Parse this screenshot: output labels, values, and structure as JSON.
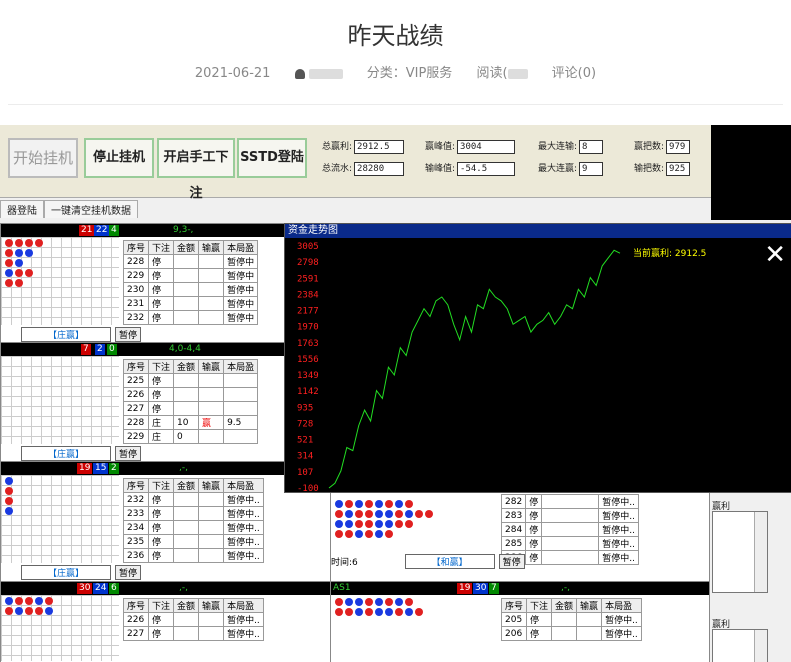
{
  "article": {
    "title": "昨天战绩",
    "date": "2021-06-21",
    "category": "分类：VIP服务",
    "reads": "阅读(",
    "comments": "评论(0)"
  },
  "toolbar": {
    "start": "开始挂机",
    "stop": "停止挂机",
    "manual": "开启手工下注",
    "login": "SSTD登陆",
    "total_win_label": "总赢利:",
    "total_win": "2912.5",
    "total_flow_label": "总流水:",
    "total_flow": "28280",
    "peak_win_label": "赢峰值:",
    "peak_win": "3004",
    "peak_loss_label": "输峰值:",
    "peak_loss": "-54.5",
    "max_win_streak_label": "最大连输:",
    "max_win_streak": "8",
    "max_loss_streak_label": "最大连赢:",
    "max_loss_streak": "9",
    "win_rounds_label": "赢把数:",
    "win_rounds": "979",
    "loss_rounds_label": "输把数:",
    "loss_rounds": "925"
  },
  "tabs": [
    "器登陆",
    "一键清空挂机数据"
  ],
  "table_headers": [
    "序号",
    "下注",
    "金额",
    "输赢",
    "本局盈"
  ],
  "panels": [
    {
      "counts": [
        "21",
        "22",
        "4"
      ],
      "info": "9,3-,",
      "rows": [
        [
          "228",
          "停",
          "",
          "",
          "暂停中"
        ],
        [
          "229",
          "停",
          "",
          "",
          "暂停中"
        ],
        [
          "230",
          "停",
          "",
          "",
          "暂停中"
        ],
        [
          "231",
          "停",
          "",
          "",
          "暂停中"
        ],
        [
          "232",
          "停",
          "",
          "",
          "暂停中"
        ]
      ],
      "bank": "【庄赢】",
      "pause": "暂停"
    },
    {
      "counts": [
        "7",
        "2",
        "0"
      ],
      "info": "4,0-4,4",
      "rows": [
        [
          "225",
          "停",
          "",
          "",
          ""
        ],
        [
          "226",
          "停",
          "",
          "",
          ""
        ],
        [
          "227",
          "停",
          "",
          "",
          ""
        ],
        [
          "228",
          "庄",
          "10",
          "赢",
          "9.5"
        ],
        [
          "229",
          "庄",
          "0",
          "",
          ""
        ]
      ],
      "bank": "【庄赢】",
      "pause": "暂停"
    },
    {
      "counts": [
        "19",
        "15",
        "2"
      ],
      "info": ",-,",
      "rows": [
        [
          "232",
          "停",
          "",
          "",
          "暂停中.."
        ],
        [
          "233",
          "停",
          "",
          "",
          "暂停中.."
        ],
        [
          "234",
          "停",
          "",
          "",
          "暂停中.."
        ],
        [
          "235",
          "停",
          "",
          "",
          "暂停中.."
        ],
        [
          "236",
          "停",
          "",
          "",
          "暂停中.."
        ]
      ],
      "bank": "【庄赢】",
      "pause": "暂停"
    },
    {
      "counts": [
        "30",
        "24",
        "6"
      ],
      "info": ",-,",
      "rows": [
        [
          "226",
          "停",
          "",
          "",
          "暂停中.."
        ],
        [
          "227",
          "停",
          "",
          "",
          "暂停中.."
        ]
      ],
      "bank": "",
      "pause": ""
    }
  ],
  "right_panel_1": {
    "rows": [
      [
        "282",
        "停",
        "",
        "",
        "暂停中.."
      ],
      [
        "283",
        "停",
        "",
        "",
        "暂停中.."
      ],
      [
        "284",
        "停",
        "",
        "",
        "暂停中.."
      ],
      [
        "285",
        "停",
        "",
        "",
        "暂停中.."
      ],
      [
        "286",
        "停",
        "",
        "",
        "暂停中.."
      ]
    ],
    "time": "时间:6",
    "bank": "【和赢】",
    "pause": "暂停"
  },
  "right_panel_2": {
    "name": "AS1",
    "counts": [
      "19",
      "30",
      "7"
    ],
    "info": ",-,",
    "rows": [
      [
        "205",
        "停",
        "",
        "",
        "暂停中.."
      ],
      [
        "206",
        "停",
        "",
        "",
        "暂停中.."
      ]
    ]
  },
  "side_labels": [
    "赢利",
    "赢利"
  ],
  "chart_window": {
    "title": "资金走势图",
    "current_label": "当前赢利: 2912.5",
    "close": "✕"
  },
  "chart_data": {
    "type": "line",
    "yticks": [
      "3005",
      "2798",
      "2591",
      "2384",
      "2177",
      "1970",
      "1763",
      "1556",
      "1349",
      "1142",
      "935",
      "728",
      "521",
      "314",
      "107",
      "-100"
    ],
    "ylim": [
      -100,
      3005
    ],
    "series": [
      {
        "color": "#22dd22",
        "values": [
          -100,
          -40,
          120,
          420,
          380,
          700,
          900,
          760,
          1150,
          1050,
          1450,
          1350,
          1700,
          1600,
          1900,
          2050,
          2200,
          2100,
          2300,
          2350,
          2250,
          2000,
          1800,
          2100,
          1900,
          2250,
          2200,
          2450,
          2350,
          2300,
          2200,
          2000,
          2050,
          2100,
          1900,
          2000,
          2050,
          2150,
          2000,
          2100,
          2250,
          2200,
          2450,
          2350,
          2600,
          2500,
          2750,
          2850,
          2950,
          2912.5
        ]
      }
    ],
    "colors": {
      "line": "#22dd22",
      "ticks": "#ff2020",
      "label": "#ffff00"
    }
  }
}
